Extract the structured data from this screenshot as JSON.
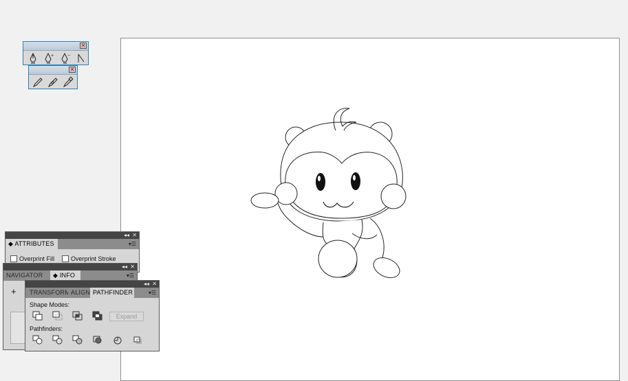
{
  "tool_panels": {
    "pen_tools": [
      "pen-tool",
      "add-anchor-point-tool",
      "delete-anchor-point-tool",
      "convert-anchor-point-tool"
    ],
    "pencil_tools": [
      "pencil-tool",
      "smooth-tool",
      "path-eraser-tool"
    ]
  },
  "attributes_panel": {
    "tab": "ATTRIBUTES",
    "overprint_fill": "Overprint Fill",
    "overprint_stroke": "Overprint Stroke"
  },
  "navigator_panel": {
    "tabs": [
      "NAVIGATOR",
      "INFO"
    ],
    "crosshair": "+"
  },
  "pathfinder_panel": {
    "tabs": [
      "TRANSFORM",
      "ALIGN",
      "PATHFINDER"
    ],
    "shape_modes_label": "Shape Modes:",
    "expand_label": "Expand",
    "pathfinders_label": "Pathfinders:",
    "shape_mode_icons": [
      "unite-icon",
      "minus-front-icon",
      "intersect-icon",
      "exclude-icon"
    ],
    "pathfinder_icons": [
      "divide-icon",
      "trim-icon",
      "merge-icon",
      "crop-icon",
      "outline-icon",
      "minus-back-icon"
    ]
  },
  "canvas": {
    "artwork": "monkey-outline"
  }
}
